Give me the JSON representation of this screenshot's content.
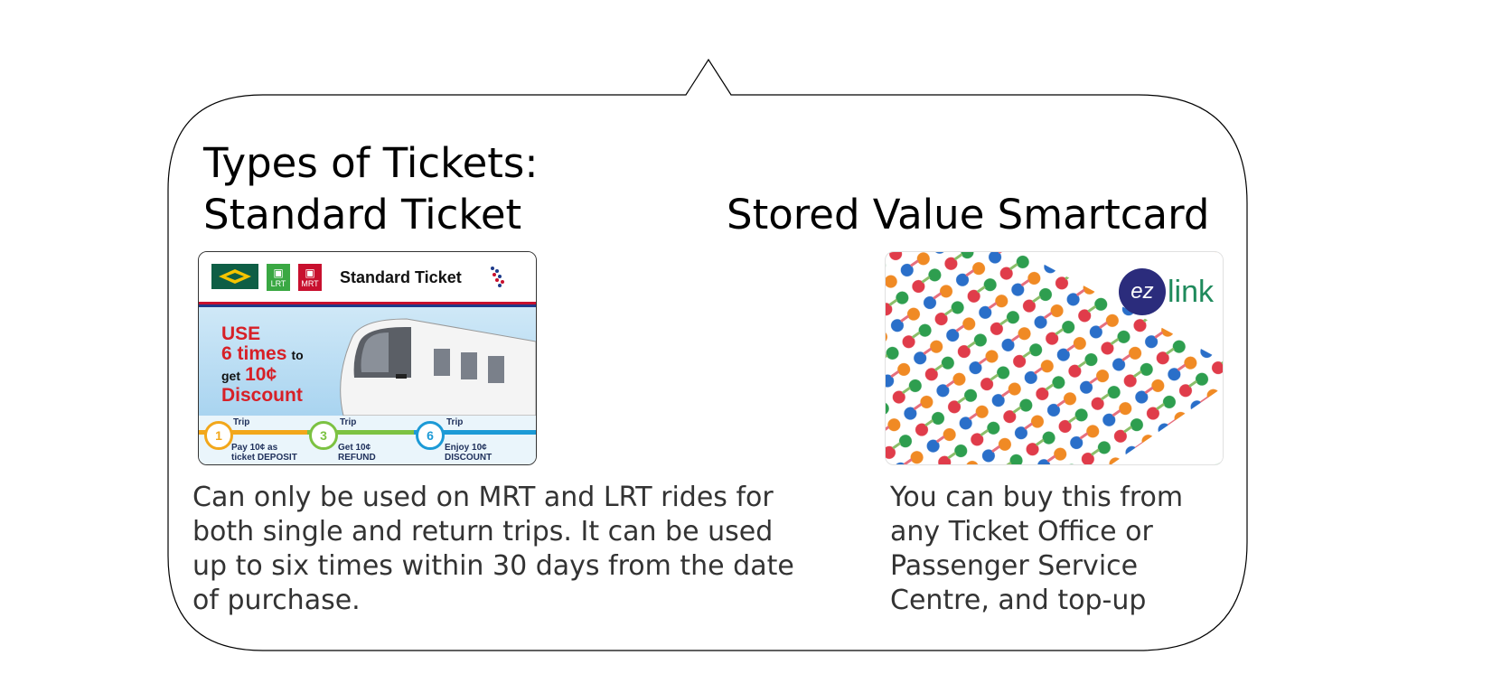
{
  "heading": {
    "types": "Types of Tickets:",
    "standard": "Standard Ticket",
    "smartcard": "Stored Value Smartcard"
  },
  "standard_card": {
    "title": "Standard Ticket",
    "logo_lrt": "LRT",
    "logo_mrt": "MRT",
    "promo_line1": "USE",
    "promo_line2": "6 times",
    "promo_to": "to",
    "promo_get": "get",
    "promo_amount": "10¢",
    "promo_line4": "Discount",
    "trips": [
      {
        "num": "1",
        "label": "Trip",
        "text1": "Pay 10¢ as",
        "text2": "ticket DEPOSIT",
        "color": "#f2a71b"
      },
      {
        "num": "3",
        "label": "Trip",
        "text1": "Get 10¢",
        "text2": "REFUND",
        "color": "#7cc242"
      },
      {
        "num": "6",
        "label": "Trip",
        "text1": "Enjoy 10¢",
        "text2": "DISCOUNT",
        "color": "#1c9ad6"
      }
    ]
  },
  "smart_card": {
    "logo_ez": "ez",
    "logo_link": "link"
  },
  "desc": {
    "standard": "Can only be used on MRT and LRT rides for both single and return trips. It can be used up to six times within 30 days from the date of purchase.",
    "smartcard": "You can buy this from any Ticket Office or Passenger Service Centre, and top-up"
  },
  "colors": {
    "bubble_border": "#000000",
    "description_text": "#333333",
    "promo_red": "#d72027",
    "ez_green": "#1f8a5c",
    "ez_navy": "#2b2c7c"
  }
}
